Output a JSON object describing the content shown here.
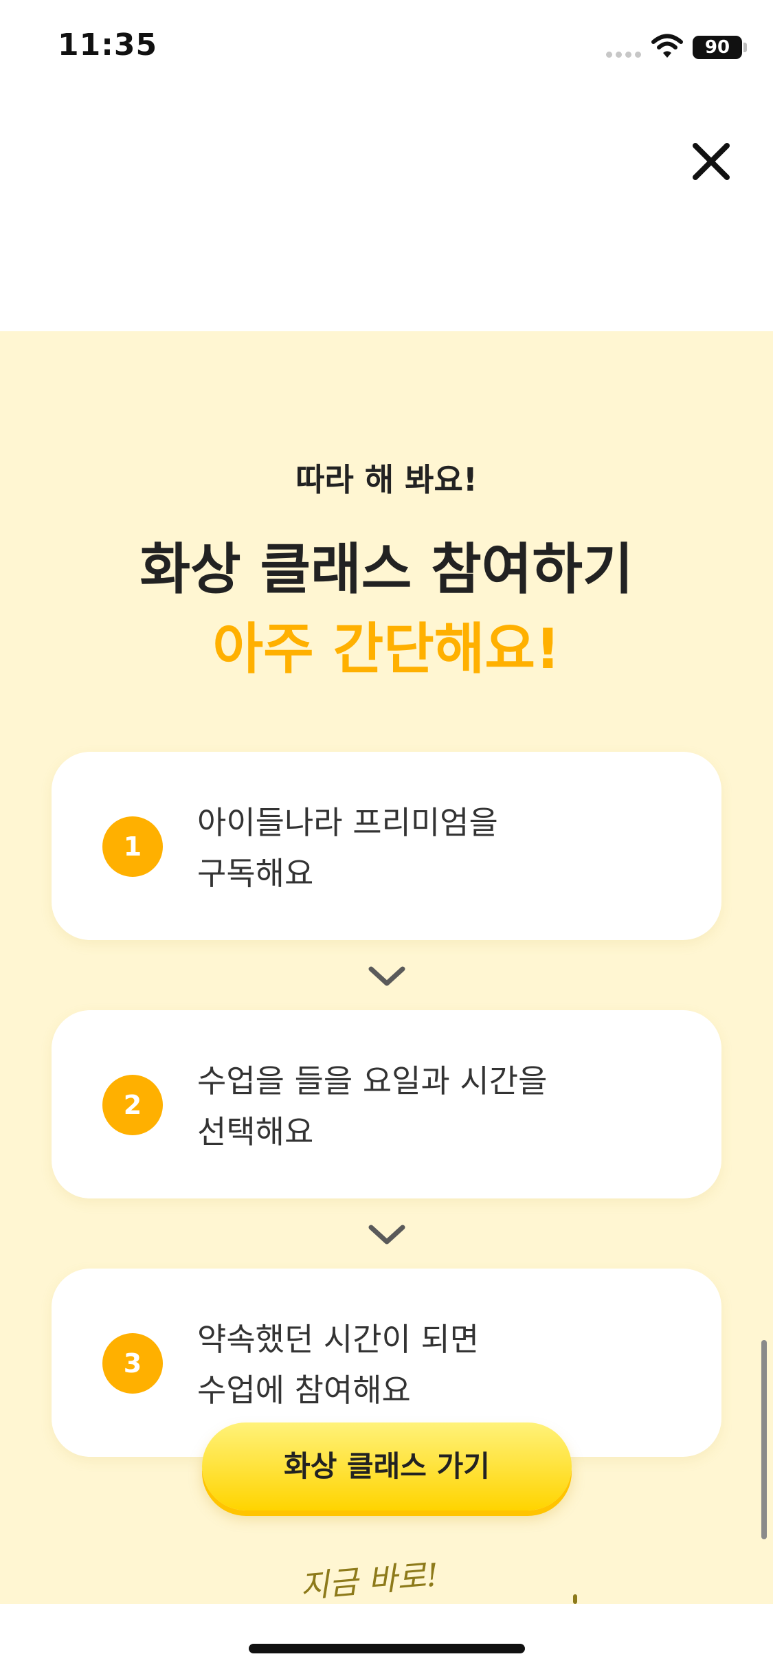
{
  "status_bar": {
    "time": "11:35",
    "battery": "90"
  },
  "icons": {
    "close": "close-icon",
    "chevron": "chevron-down-icon",
    "wifi": "wifi-icon",
    "signal": "signal-icon"
  },
  "colors": {
    "panel_background": "#fff6d2",
    "accent": "#ffb000",
    "cta": "#ffd400"
  },
  "intro": {
    "kicker": "따라 해 봐요!",
    "headline": "화상 클래스 참여하기",
    "accent": "아주 간단해요!"
  },
  "steps": [
    {
      "number": "1",
      "line1": "아이들나라 프리미엄을",
      "line2": "구독해요"
    },
    {
      "number": "2",
      "line1": "수업을 들을 요일과 시간을",
      "line2": "선택해요"
    },
    {
      "number": "3",
      "line1": "약속했던 시간이 되면",
      "line2": "수업에 참여해요"
    }
  ],
  "cta": {
    "label": "화상 클래스 가기"
  },
  "handwriting": "지금 바로!"
}
